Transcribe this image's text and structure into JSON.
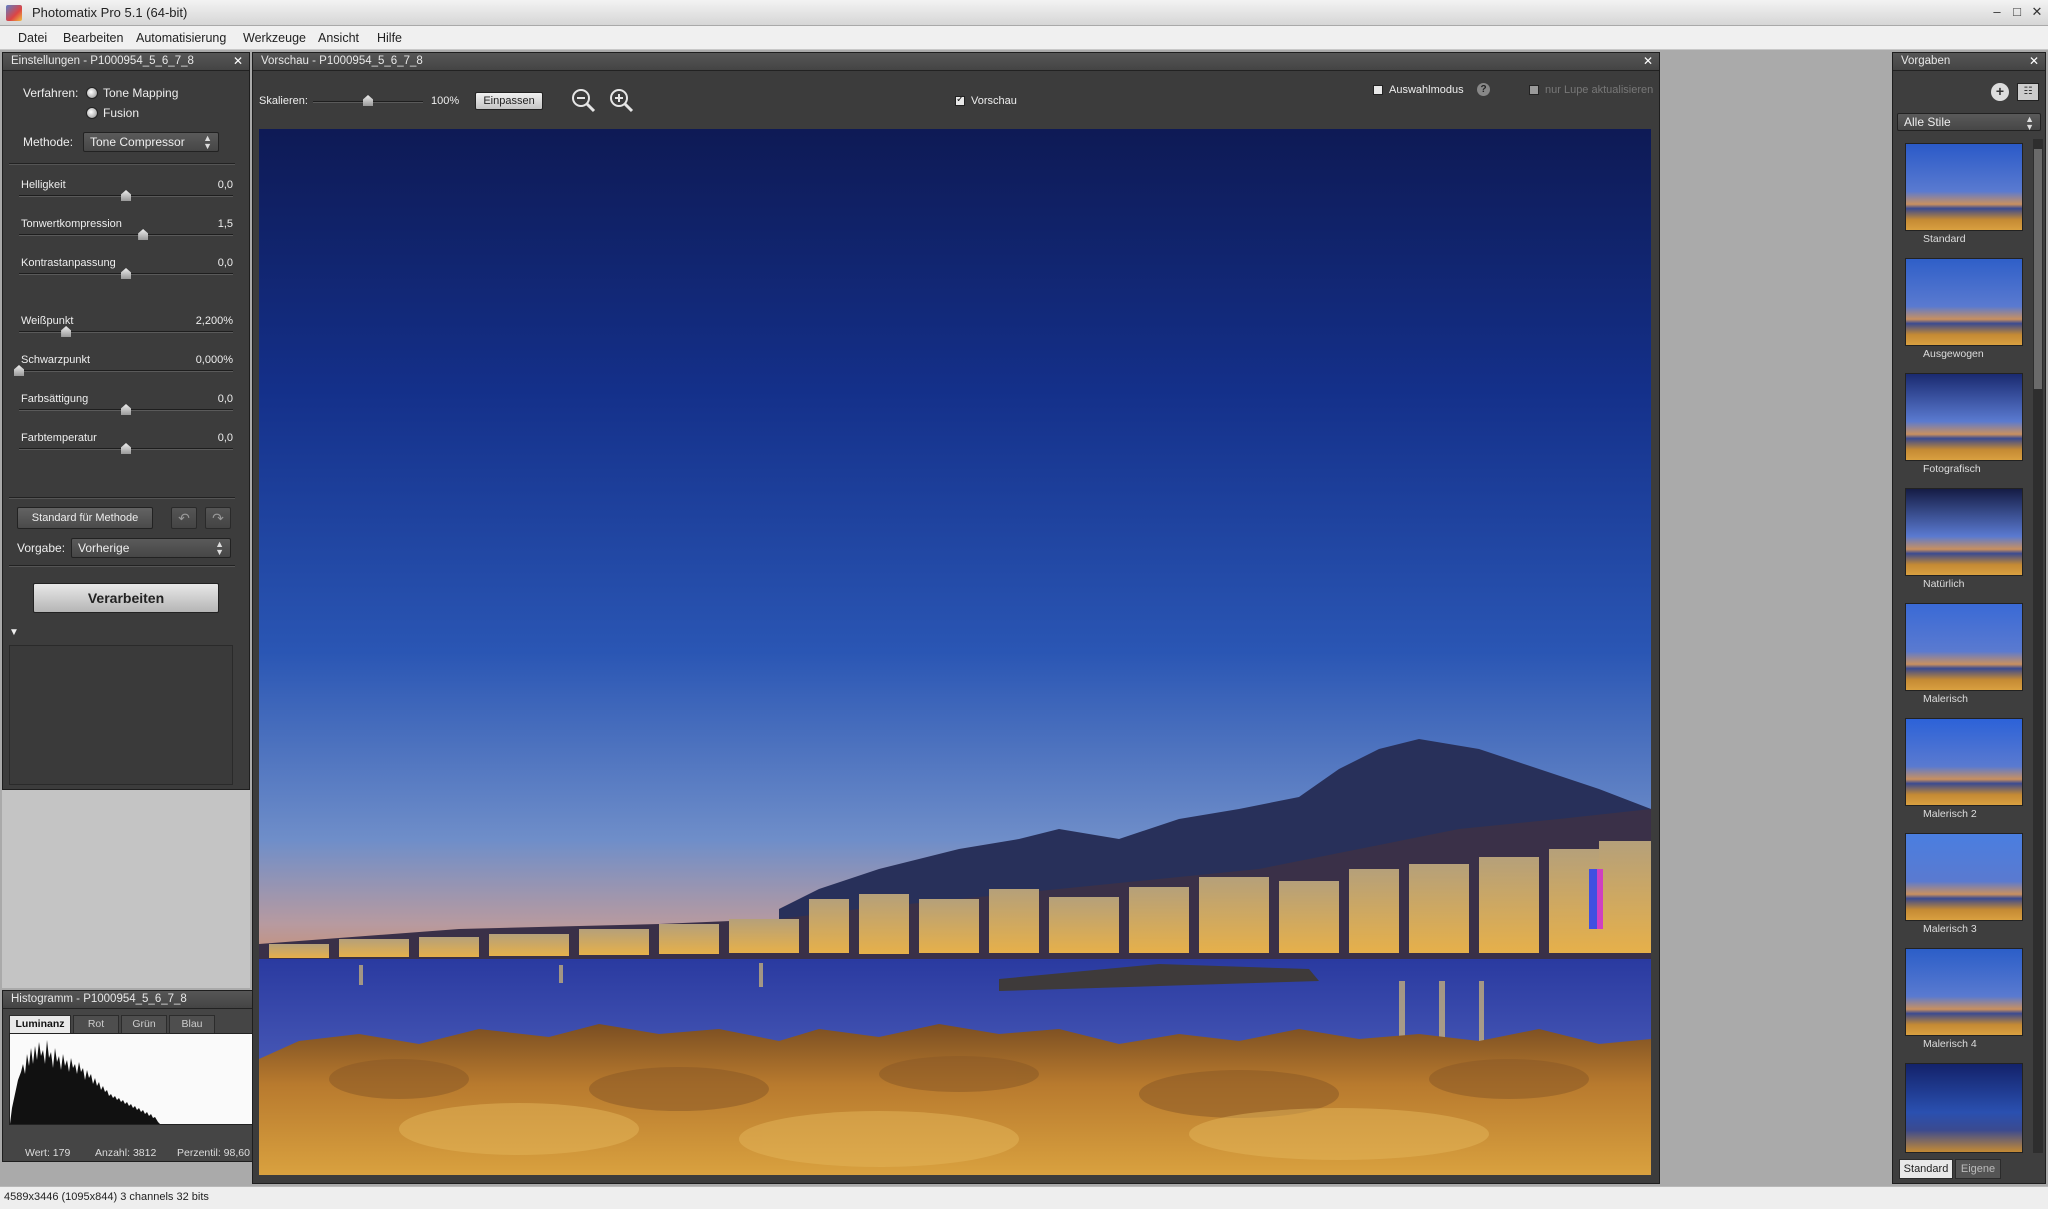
{
  "window": {
    "title": "Photomatix Pro 5.1 (64-bit)",
    "minimize": "–",
    "maximize": "□",
    "close": "✕"
  },
  "menu": [
    "Datei",
    "Bearbeiten",
    "Automatisierung",
    "Werkzeuge",
    "Ansicht",
    "Hilfe"
  ],
  "settings": {
    "header": "Einstellungen - P1000954_5_6_7_8",
    "verfahren_label": "Verfahren:",
    "option_tone_mapping": "Tone Mapping",
    "option_fusion": "Fusion",
    "methode_label": "Methode:",
    "methode_value": "Tone Compressor",
    "sliders": [
      {
        "name": "Helligkeit",
        "value": "0,0",
        "position": 0.5
      },
      {
        "name": "Tonwertkompression",
        "value": "1,5",
        "position": 0.58
      },
      {
        "name": "Kontrastanpassung",
        "value": "0,0",
        "position": 0.5
      },
      {
        "name": "Weißpunkt",
        "value": "2,200%",
        "position": 0.22
      },
      {
        "name": "Schwarzpunkt",
        "value": "0,000%",
        "position": 0.0
      },
      {
        "name": "Farbsättigung",
        "value": "0,0",
        "position": 0.5
      },
      {
        "name": "Farbtemperatur",
        "value": "0,0",
        "position": 0.5
      }
    ],
    "standard_button": "Standard für Methode",
    "undo_icon": "undo-icon",
    "redo_icon": "redo-icon",
    "vorgabe_label": "Vorgabe:",
    "vorgabe_value": "Vorherige",
    "process_button": "Verarbeiten",
    "expand_arrow": "▼"
  },
  "histogram": {
    "header": "Histogramm - P1000954_5_6_7_8",
    "tabs": [
      "Luminanz",
      "Rot",
      "Grün",
      "Blau"
    ],
    "active_tab": "Luminanz",
    "wert": "Wert: 179",
    "anzahl": "Anzahl: 3812",
    "perzentil": "Perzentil: 98,60"
  },
  "preview": {
    "header": "Vorschau - P1000954_5_6_7_8",
    "scale_label": "Skalieren:",
    "scale_value": "100%",
    "scale_position": 0.5,
    "fit_button": "Einpassen",
    "preview_checkbox": "Vorschau",
    "preview_checked": true,
    "selection_mode": "Auswahlmodus",
    "selection_checked": false,
    "loupe_update": "nur Lupe aktualisieren",
    "help_icon": "?"
  },
  "presets": {
    "header": "Vorgaben",
    "filter_value": "Alle Stile",
    "items": [
      "Standard",
      "Ausgewogen",
      "Fotografisch",
      "Natürlich",
      "Malerisch",
      "Malerisch 2",
      "Malerisch 3",
      "Malerisch 4"
    ],
    "tabs": [
      "Standard",
      "Eigene"
    ]
  },
  "status": {
    "text": "4589x3446 (1095x844) 3 channels 32 bits"
  },
  "colors": {
    "panel_bg": "#3c3c3c",
    "workspace_bg": "#aaaaaa",
    "sky_top": "#0f1d5c",
    "sky_horizon": "#c89070",
    "rocks": "#c98a30"
  }
}
